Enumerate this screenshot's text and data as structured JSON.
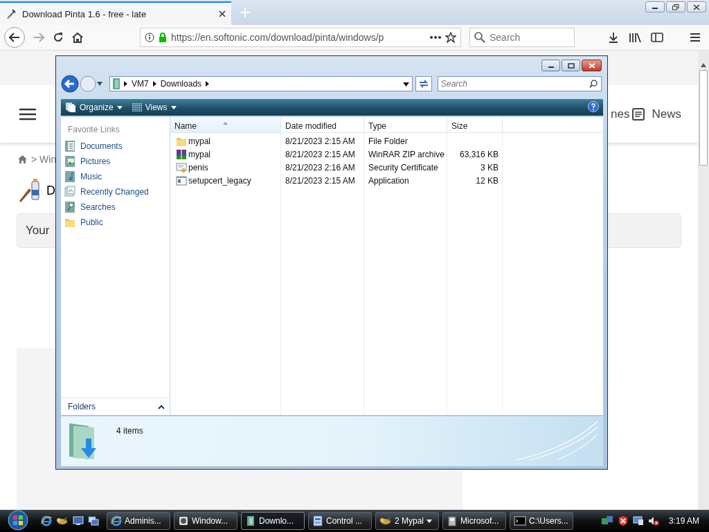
{
  "browser": {
    "tabs": [
      {
        "title": "Download Pinta 1.6 - free - late",
        "selected": true
      }
    ],
    "url": "https://en.softonic.com/download/pinta/windows/p",
    "search": {
      "placeholder": "Search"
    }
  },
  "page": {
    "header_link_cut": "nes",
    "news": "News",
    "breadcrumb": "> Win",
    "heading": "D",
    "notice": "Your"
  },
  "explorer": {
    "path": [
      "VM7",
      "Downloads"
    ],
    "search": {
      "placeholder": "Search"
    },
    "toolbar": [
      {
        "label": "Organize",
        "kind": "organize"
      },
      {
        "label": "Views",
        "kind": "views"
      }
    ],
    "favorite_links": {
      "title": "Favorite Links",
      "items": [
        {
          "label": "Documents",
          "kind": "documents"
        },
        {
          "label": "Pictures",
          "kind": "pictures"
        },
        {
          "label": "Music",
          "kind": "music"
        },
        {
          "label": "Recently Changed",
          "kind": "recent"
        },
        {
          "label": "Searches",
          "kind": "searches"
        },
        {
          "label": "Public",
          "kind": "folder"
        }
      ]
    },
    "folders_label": "Folders",
    "columns": [
      {
        "label": "Name",
        "sorted": true
      },
      {
        "label": "Date modified",
        "sorted": false
      },
      {
        "label": "Type",
        "sorted": false
      },
      {
        "label": "Size",
        "sorted": false
      }
    ],
    "rows": [
      {
        "kind": "folder",
        "name": "mypal",
        "date": "8/21/2023 2:15 AM",
        "type": "File Folder",
        "size": ""
      },
      {
        "kind": "zip",
        "name": "mypal",
        "date": "8/21/2023 2:15 AM",
        "type": "WinRAR ZIP archive",
        "size": "63,316 KB"
      },
      {
        "kind": "certificate",
        "name": "penis",
        "date": "8/21/2023 2:16 AM",
        "type": "Security Certificate",
        "size": "3 KB"
      },
      {
        "kind": "app",
        "name": "setupcert_legacy",
        "date": "8/21/2023 2:15 AM",
        "type": "Application",
        "size": "12 KB"
      }
    ],
    "status": "4 items"
  },
  "taskbar": {
    "buttons": [
      {
        "label": "Adminis...",
        "kind": "ie",
        "selected": false
      },
      {
        "label": "Window...",
        "kind": "media",
        "selected": false
      },
      {
        "label": "Downlo...",
        "kind": "explorer",
        "selected": true
      },
      {
        "label": "Control ...",
        "kind": "control",
        "selected": false
      },
      {
        "label": "2 Mypal",
        "kind": "mypal",
        "selected": false
      },
      {
        "label": "Microsof...",
        "kind": "setup",
        "selected": false
      },
      {
        "label": "C:\\Users...",
        "kind": "console",
        "selected": false
      }
    ],
    "clock": "3:19 AM"
  }
}
